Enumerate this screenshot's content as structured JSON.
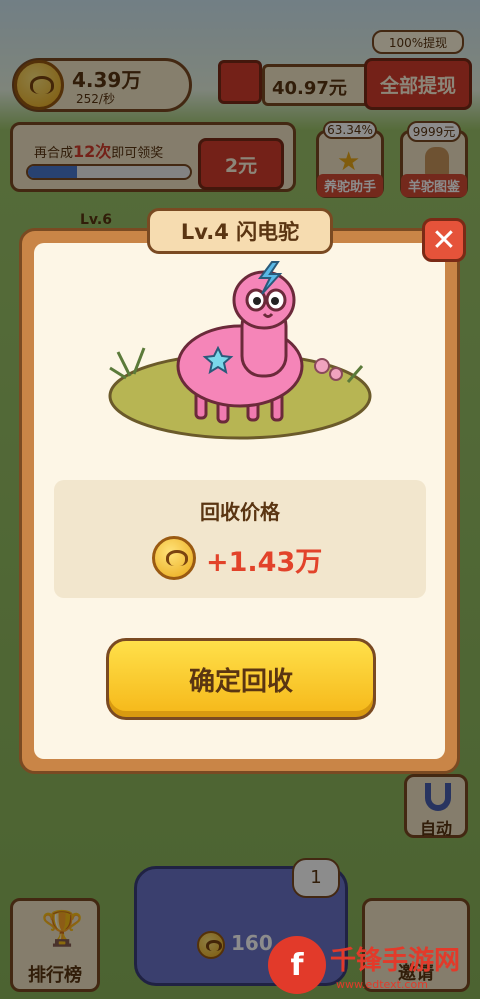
{
  "header": {
    "coin_amount": "4.39万",
    "coin_rate": "252/秒",
    "cash_amount": "40.97元",
    "withdraw_all_label": "全部提现",
    "withdraw_badge": "100%提现"
  },
  "progress": {
    "text_prefix": "再合成",
    "count": "12次",
    "text_suffix": "即可领奖",
    "reward_label": "2元",
    "fill": 0.3
  },
  "cards": [
    {
      "badge": "63.34%",
      "label": "养驼助手"
    },
    {
      "badge": "9999元",
      "label": "羊驼图鉴"
    }
  ],
  "level_tag": "Lv.6",
  "modal": {
    "title": "Lv.4 闪电驼",
    "close_icon": "close-icon",
    "price_title": "回收价格",
    "price_value": "+1.43万",
    "confirm_label": "确定回收"
  },
  "bottom": {
    "rank_label": "排行榜",
    "auto_label": "自动",
    "buy_amount": "160",
    "notify_count": "1",
    "invite_label": "邀请"
  },
  "watermark": {
    "name": "千锋手游网",
    "url": "www.edtext.com"
  },
  "colors": {
    "accent_red": "#d43d2c",
    "confirm_yellow": "#f5b718",
    "price_red": "#e2432a"
  }
}
